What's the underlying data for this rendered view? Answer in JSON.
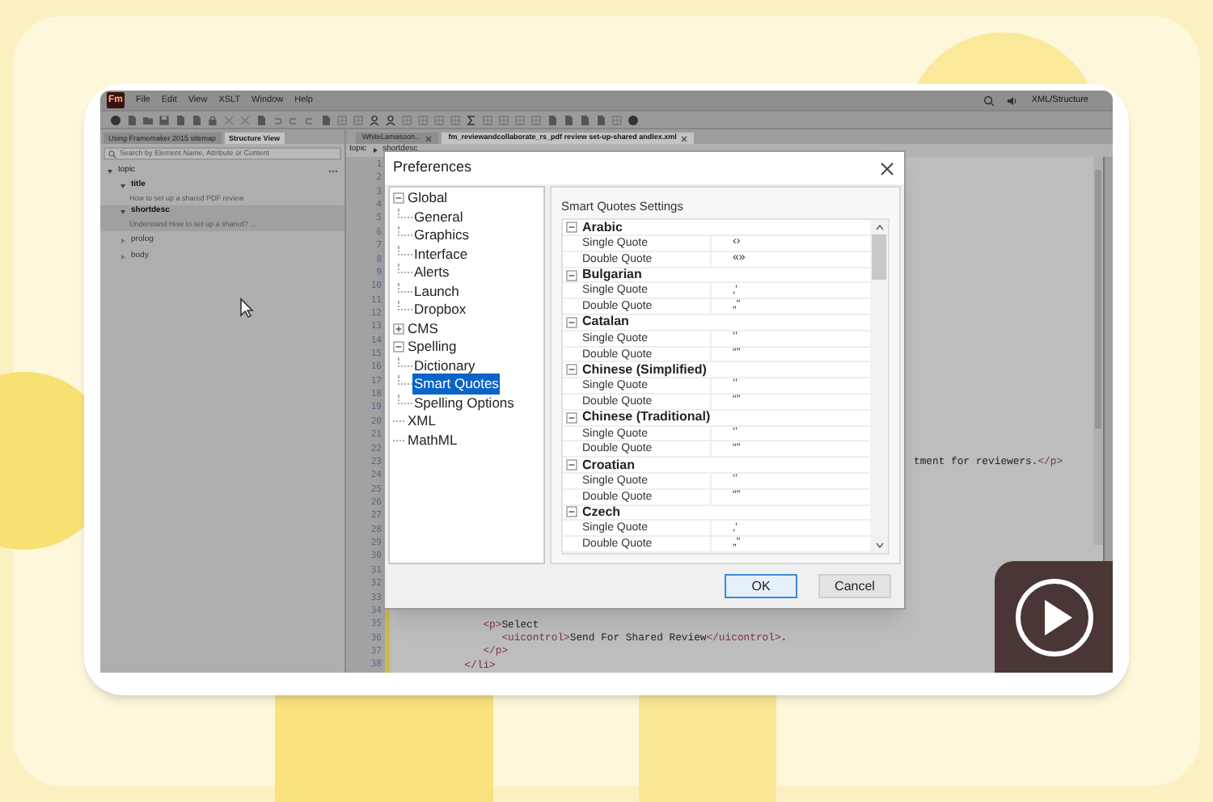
{
  "app": {
    "logo": "Fm",
    "menu": [
      "File",
      "Edit",
      "View",
      "XSLT",
      "Window",
      "Help"
    ],
    "workspace": "XML/Structure"
  },
  "panel_tabs": [
    {
      "label": "Using Framemaker 2015 sitemap",
      "selected": false
    },
    {
      "label": "Structure View",
      "selected": true
    }
  ],
  "structure_search": {
    "placeholder": "Search by Element Name, Attribute or Content"
  },
  "structure_tree": [
    {
      "label": "topic",
      "expanded": true,
      "children": [
        {
          "label": "title",
          "expanded": true,
          "content": "How to set up a shared PDF review",
          "selected": false
        },
        {
          "label": "shortdesc",
          "expanded": true,
          "content": "Understand How to set up a shared? ...",
          "selected": true
        },
        {
          "label": "prolog",
          "expanded": false,
          "selected": false
        },
        {
          "label": "body",
          "expanded": false,
          "selected": false
        }
      ]
    }
  ],
  "doc_tabs": [
    {
      "label": "WhiteLamasoon...",
      "selected": false
    },
    {
      "label": "fm_reviewandcollaborate_rs_pdf review set-up-shared andlex.xml",
      "selected": true
    }
  ],
  "breadcrumb": [
    "topic",
    "shortdesc"
  ],
  "editor": {
    "lines": [
      {
        "number": "1"
      },
      {
        "number": "2"
      },
      {
        "number": "3"
      },
      {
        "number": "4"
      },
      {
        "number": "5"
      },
      {
        "number": "6"
      },
      {
        "number": "7"
      },
      {
        "number": "8"
      },
      {
        "number": "9"
      },
      {
        "number": "10"
      },
      {
        "number": "11"
      },
      {
        "number": "12"
      },
      {
        "number": "13"
      },
      {
        "number": "14"
      },
      {
        "number": "15"
      },
      {
        "number": "16"
      },
      {
        "number": "17"
      },
      {
        "number": "18"
      },
      {
        "number": "19"
      },
      {
        "number": "20"
      },
      {
        "number": "21"
      },
      {
        "number": "22"
      },
      {
        "number": "23",
        "kind": "partial",
        "code": [
          {
            "kind": "text",
            "text": "tment for reviewers."
          },
          {
            "kind": "tag",
            "text": "</p>"
          }
        ]
      },
      {
        "number": "24"
      },
      {
        "number": "25"
      },
      {
        "number": "26"
      },
      {
        "number": "27"
      },
      {
        "number": "28"
      },
      {
        "number": "29"
      },
      {
        "number": "30"
      },
      {
        "number": "31"
      },
      {
        "number": "32"
      },
      {
        "number": "33"
      },
      {
        "number": "34"
      },
      {
        "number": "35",
        "kind": "full",
        "code": [
          {
            "kind": "tag",
            "text": "              <p>"
          },
          {
            "kind": "text",
            "text": "Select"
          }
        ]
      },
      {
        "number": "36",
        "kind": "full",
        "code": [
          {
            "kind": "tag",
            "text": "                 <uicontrol>"
          },
          {
            "kind": "text",
            "text": "Send For Shared Review"
          },
          {
            "kind": "tag",
            "text": "</uicontrol>"
          },
          {
            "kind": "text",
            "text": "."
          }
        ]
      },
      {
        "number": "37",
        "kind": "full",
        "code": [
          {
            "kind": "tag",
            "text": "              </p>"
          }
        ]
      },
      {
        "number": "38",
        "kind": "full",
        "code": [
          {
            "kind": "tag",
            "text": "           </li>"
          }
        ]
      }
    ]
  },
  "dialog": {
    "title": "Preferences",
    "tree": [
      {
        "label": "Global",
        "expanded": true,
        "selected": false,
        "children": [
          {
            "label": "General",
            "selected": false
          },
          {
            "label": "Graphics",
            "selected": false
          },
          {
            "label": "Interface",
            "selected": false
          },
          {
            "label": "Alerts",
            "selected": false
          },
          {
            "label": "Launch",
            "selected": false
          },
          {
            "label": "Dropbox",
            "selected": false
          }
        ]
      },
      {
        "label": "CMS",
        "expanded": false,
        "selected": false
      },
      {
        "label": "Spelling",
        "expanded": true,
        "selected": false,
        "children": [
          {
            "label": "Dictionary",
            "selected": false
          },
          {
            "label": "Smart Quotes",
            "selected": true
          },
          {
            "label": "Spelling Options",
            "selected": false
          }
        ]
      },
      {
        "label": "XML",
        "selected": false
      },
      {
        "label": "MathML",
        "selected": false
      }
    ],
    "section_title": "Smart Quotes Settings",
    "languages": [
      {
        "name": "Arabic",
        "expanded": true,
        "rows": [
          {
            "label": "Single Quote",
            "value": "‹›"
          },
          {
            "label": "Double Quote",
            "value": "«»"
          }
        ]
      },
      {
        "name": "Bulgarian",
        "expanded": true,
        "rows": [
          {
            "label": "Single Quote",
            "value": "‚‘"
          },
          {
            "label": "Double Quote",
            "value": "„“"
          }
        ]
      },
      {
        "name": "Catalan",
        "expanded": true,
        "rows": [
          {
            "label": "Single Quote",
            "value": "‘’"
          },
          {
            "label": "Double Quote",
            "value": "“”"
          }
        ]
      },
      {
        "name": "Chinese (Simplified)",
        "expanded": true,
        "rows": [
          {
            "label": "Single Quote",
            "value": "‘’"
          },
          {
            "label": "Double Quote",
            "value": "“”"
          }
        ]
      },
      {
        "name": "Chinese (Traditional)",
        "expanded": true,
        "rows": [
          {
            "label": "Single Quote",
            "value": "‘’"
          },
          {
            "label": "Double Quote",
            "value": "“”"
          }
        ]
      },
      {
        "name": "Croatian",
        "expanded": true,
        "rows": [
          {
            "label": "Single Quote",
            "value": "‘’"
          },
          {
            "label": "Double Quote",
            "value": "“”"
          }
        ]
      },
      {
        "name": "Czech",
        "expanded": true,
        "rows": [
          {
            "label": "Single Quote",
            "value": "‚‘"
          },
          {
            "label": "Double Quote",
            "value": "„“"
          }
        ]
      }
    ],
    "buttons": [
      {
        "label": "OK",
        "kind": "default"
      },
      {
        "label": "Cancel",
        "kind": "normal"
      }
    ]
  }
}
